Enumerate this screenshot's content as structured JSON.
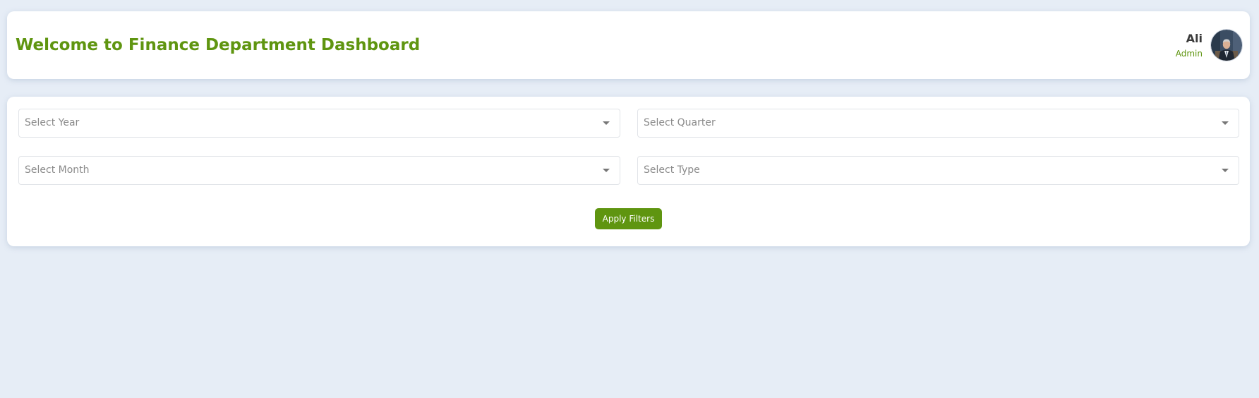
{
  "header": {
    "title": "Welcome to Finance Department Dashboard",
    "user": {
      "name": "Ali",
      "role": "Admin"
    }
  },
  "filters": {
    "year": {
      "placeholder": "Select Year"
    },
    "quarter": {
      "placeholder": "Select Quarter"
    },
    "month": {
      "placeholder": "Select Month"
    },
    "type": {
      "placeholder": "Select Type"
    },
    "apply_label": "Apply Filters"
  },
  "colors": {
    "accent": "#5f9510",
    "background": "#e6edf6",
    "card": "#ffffff",
    "placeholder_text": "#8a8a8a"
  },
  "icons": {
    "avatar": "user-avatar-photo",
    "select_caret": "chevron-down-icon"
  }
}
